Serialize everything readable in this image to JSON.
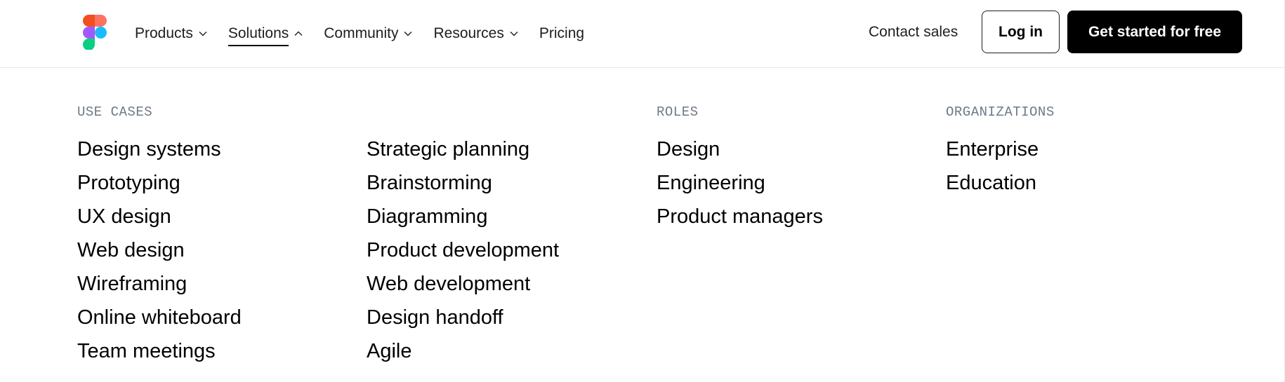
{
  "header": {
    "logo": "figma-logo",
    "nav": [
      {
        "label": "Products",
        "chevron": "down",
        "active": false
      },
      {
        "label": "Solutions",
        "chevron": "up",
        "active": true
      },
      {
        "label": "Community",
        "chevron": "down",
        "active": false
      },
      {
        "label": "Resources",
        "chevron": "down",
        "active": false
      },
      {
        "label": "Pricing",
        "chevron": null,
        "active": false
      }
    ],
    "contact_sales": "Contact sales",
    "login": "Log in",
    "get_started": "Get started for free"
  },
  "dropdown": {
    "use_cases": {
      "heading": "USE CASES",
      "items_col1": [
        "Design systems",
        "Prototyping",
        "UX design",
        "Web design",
        "Wireframing",
        "Online whiteboard",
        "Team meetings"
      ],
      "items_col2": [
        "Strategic planning",
        "Brainstorming",
        "Diagramming",
        "Product development",
        "Web development",
        "Design handoff",
        "Agile"
      ]
    },
    "roles": {
      "heading": "ROLES",
      "items": [
        "Design",
        "Engineering",
        "Product managers"
      ]
    },
    "organizations": {
      "heading": "ORGANIZATIONS",
      "items": [
        "Enterprise",
        "Education"
      ]
    }
  },
  "colors": {
    "logo_red": "#f24e1e",
    "logo_salmon": "#ff7262",
    "logo_purple": "#a259ff",
    "logo_blue": "#1abcfe",
    "logo_green": "#0acf83",
    "heading_gray": "#6f7a87",
    "divider": "#e6e6e6"
  }
}
